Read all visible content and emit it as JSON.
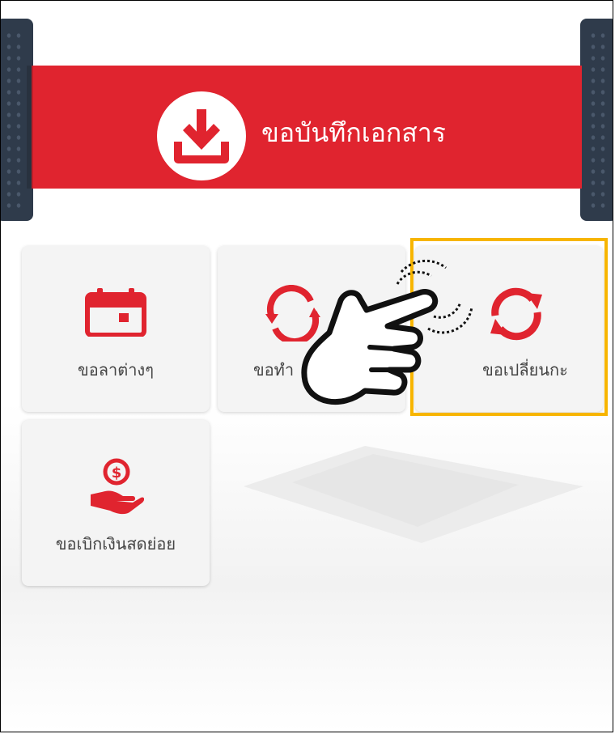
{
  "banner": {
    "title": "ขอบันทึกเอกสาร",
    "icon": "download-icon",
    "color": "#e0242f"
  },
  "tiles": [
    {
      "label": "ขอลาต่างๆ",
      "icon": "calendar-icon"
    },
    {
      "label": "ขอทำ",
      "icon": "refresh-clock-icon"
    },
    {
      "label": "ขอเปลี่ยนกะ",
      "icon": "refresh-icon"
    },
    {
      "label": "ขอเบิกเงินสดย่อย",
      "icon": "cash-hand-icon"
    }
  ],
  "overlay": {
    "highlight_color": "#f7b500",
    "pointer_icon": "hand-pointer-icon"
  },
  "colors": {
    "accent": "#e0242f",
    "side_rail": "#2f3b4b",
    "tile_bg": "#f4f4f4"
  }
}
